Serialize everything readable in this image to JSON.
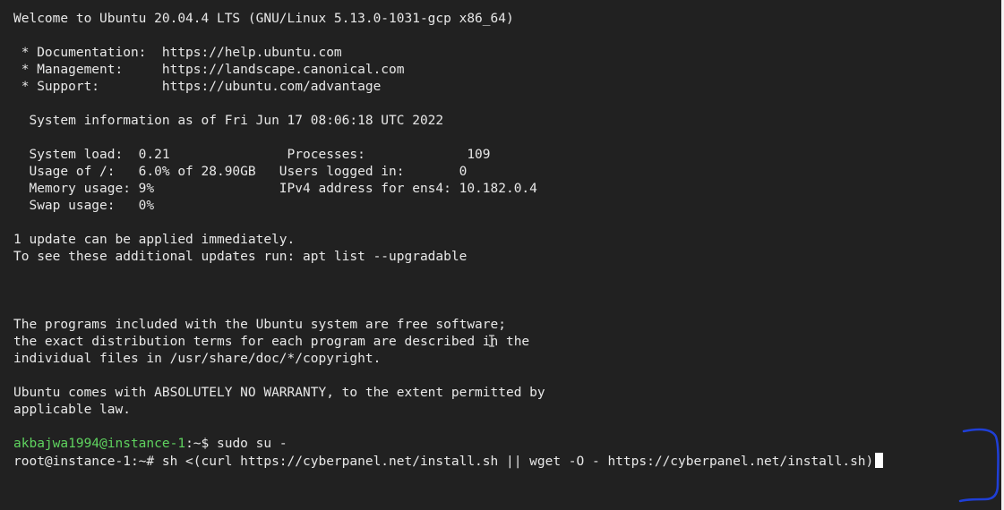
{
  "terminal": {
    "lines": [
      "Welcome to Ubuntu 20.04.4 LTS (GNU/Linux 5.13.0-1031-gcp x86_64)",
      "",
      " * Documentation:  https://help.ubuntu.com",
      " * Management:     https://landscape.canonical.com",
      " * Support:        https://ubuntu.com/advantage",
      "",
      "  System information as of Fri Jun 17 08:06:18 UTC 2022",
      "",
      "  System load:  0.21               Processes:             109",
      "  Usage of /:   6.0% of 28.90GB   Users logged in:       0",
      "  Memory usage: 9%                IPv4 address for ens4: 10.182.0.4",
      "  Swap usage:   0%",
      "",
      "1 update can be applied immediately.",
      "To see these additional updates run: apt list --upgradable",
      "",
      "",
      "",
      "The programs included with the Ubuntu system are free software;",
      "the exact distribution terms for each program are described in the",
      "individual files in /usr/share/doc/*/copyright.",
      "",
      "Ubuntu comes with ABSOLUTELY NO WARRANTY, to the extent permitted by",
      "applicable law.",
      ""
    ],
    "prompt1": {
      "user_host": "akbajwa1994@instance-1",
      "rest": ":~$ sudo su -"
    },
    "prompt2": {
      "text": "root@instance-1:~# sh <(curl https://cyberpanel.net/install.sh || wget -O - https://cyberpanel.net/install.sh)"
    }
  },
  "colors": {
    "background": "#212121",
    "text": "#e8e8e8",
    "prompt_user": "#5fd35f",
    "annotation": "#1f3fd6"
  },
  "icons": {
    "annotation": "blue-bracket-annotation-icon",
    "pointer": "text-cursor-icon"
  }
}
